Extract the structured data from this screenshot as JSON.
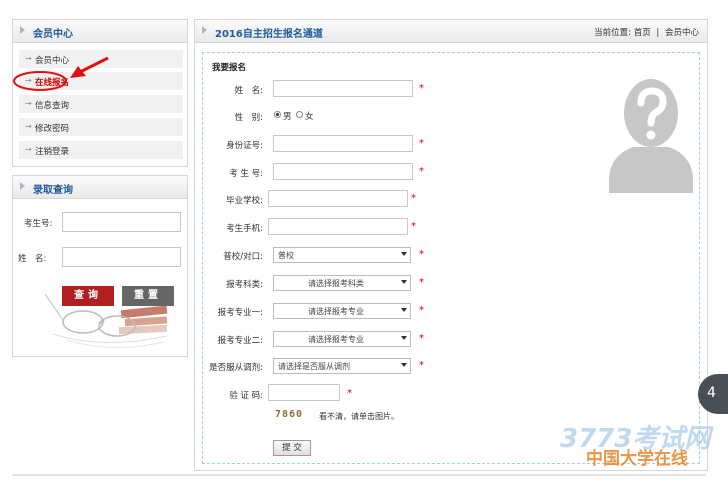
{
  "left_menu": {
    "title": "会员中心",
    "items": [
      {
        "label": "会员中心"
      },
      {
        "label": "在线报名"
      },
      {
        "label": "信息查询"
      },
      {
        "label": "修改密码"
      },
      {
        "label": "注销登录"
      }
    ]
  },
  "query_panel": {
    "title": "录取查询",
    "exam_no_label": "考生号:",
    "name_label": "姓　名:",
    "query_button": "查询",
    "reset_button": "重置"
  },
  "main": {
    "title": "2016自主招生报名通道",
    "location_label": "当前位置:",
    "breadcrumb_home": "首页",
    "breadcrumb_sep": "|",
    "breadcrumb_current": "会员中心",
    "form_title": "我要报名",
    "fields": {
      "name": "姓　名:",
      "gender": "性　别:",
      "gender_male": "男",
      "gender_female": "女",
      "id_card": "身份证号:",
      "exam_no": "考 生 号:",
      "school": "毕业学校:",
      "phone": "考生手机:",
      "track": "普校/对口:",
      "track_value": "普校",
      "subject": "报考科类:",
      "subject_value": "请选择报考科类",
      "major1": "报考专业一:",
      "major1_value": "请选择报考专业",
      "major2": "报考专业二:",
      "major2_value": "请选择报考专业",
      "adjust": "是否服从调剂:",
      "adjust_value": "请选择是否服从调剂",
      "captcha": "验 证 码:",
      "captcha_code": "7860",
      "captcha_hint": "看不清，请单击图片。",
      "submit": "提 交",
      "required_mark": "*"
    }
  },
  "side_tab": {
    "label": "4"
  },
  "watermark": {
    "line1": "3773考试网",
    "line2": "中国大学在线"
  },
  "colors": {
    "title_blue": "#1f5b99",
    "required_red": "#dd0000",
    "button_red": "#b02020",
    "button_gray": "#666666",
    "annotation_red": "#e01010"
  }
}
